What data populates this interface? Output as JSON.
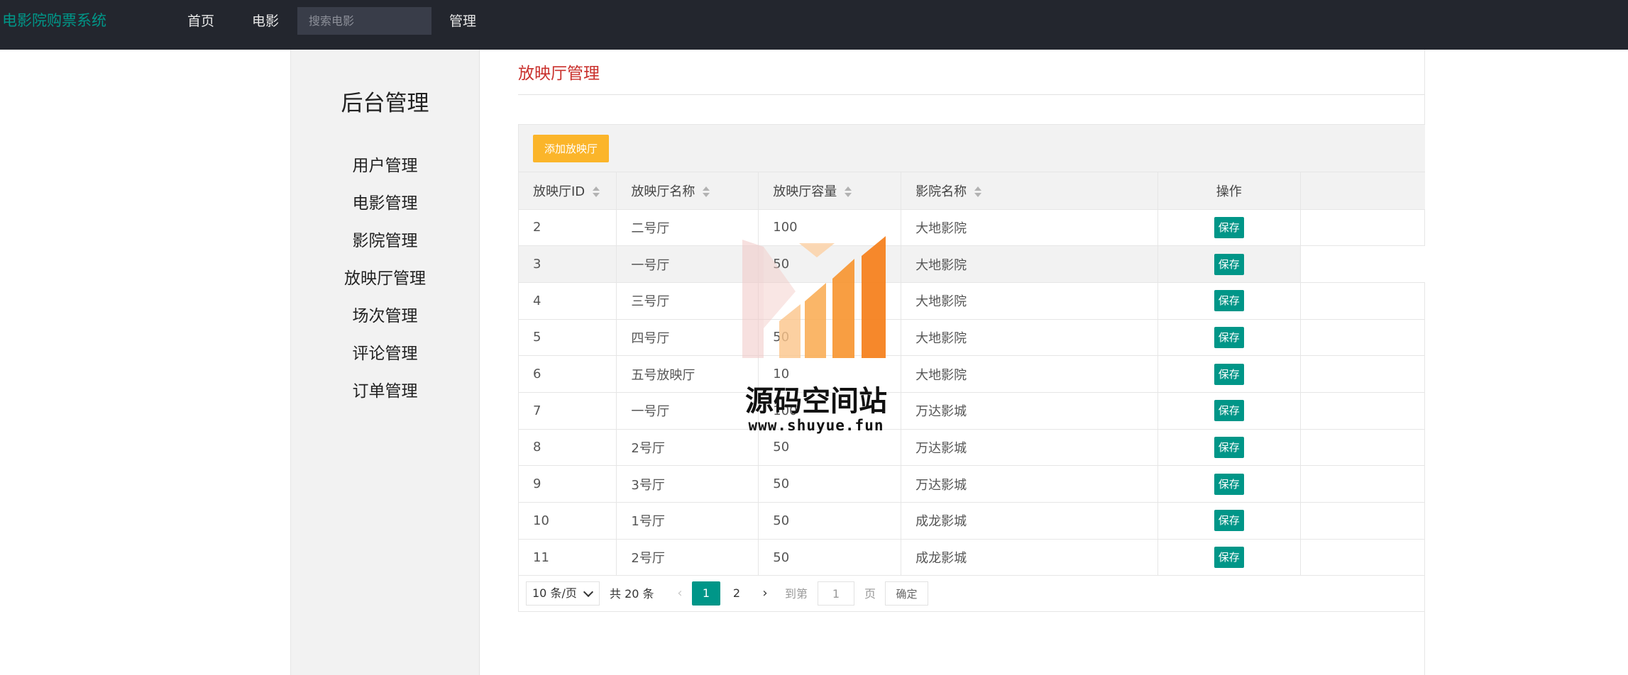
{
  "header": {
    "brand": "电影院购票系统",
    "nav": {
      "home": "首页",
      "movie": "电影",
      "admin": "管理"
    },
    "search_placeholder": "搜索电影"
  },
  "sidebar": {
    "title": "后台管理",
    "items": [
      "用户管理",
      "电影管理",
      "影院管理",
      "放映厅管理",
      "场次管理",
      "评论管理",
      "订单管理"
    ]
  },
  "main": {
    "title": "放映厅管理",
    "add_button": "添加放映厅",
    "columns": [
      "放映厅ID",
      "放映厅名称",
      "放映厅容量",
      "影院名称",
      "操作"
    ],
    "rows": [
      {
        "id": "2",
        "name": "二号厅",
        "capacity": "100",
        "cinema": "大地影院",
        "action": "保存"
      },
      {
        "id": "3",
        "name": "一号厅",
        "capacity": "50",
        "cinema": "大地影院",
        "action": "保存"
      },
      {
        "id": "4",
        "name": "三号厅",
        "capacity": "",
        "cinema": "大地影院",
        "action": "保存"
      },
      {
        "id": "5",
        "name": "四号厅",
        "capacity": "50",
        "cinema": "大地影院",
        "action": "保存"
      },
      {
        "id": "6",
        "name": "五号放映厅",
        "capacity": "10",
        "cinema": "大地影院",
        "action": "保存"
      },
      {
        "id": "7",
        "name": "一号厅",
        "capacity": "100",
        "cinema": "万达影城",
        "action": "保存"
      },
      {
        "id": "8",
        "name": "2号厅",
        "capacity": "50",
        "cinema": "万达影城",
        "action": "保存"
      },
      {
        "id": "9",
        "name": "3号厅",
        "capacity": "50",
        "cinema": "万达影城",
        "action": "保存"
      },
      {
        "id": "10",
        "name": "1号厅",
        "capacity": "50",
        "cinema": "成龙影城",
        "action": "保存"
      },
      {
        "id": "11",
        "name": "2号厅",
        "capacity": "50",
        "cinema": "成龙影城",
        "action": "保存"
      }
    ],
    "pagination": {
      "limit": "10 条/页",
      "total": "共 20 条",
      "current": "1",
      "next_page": "2",
      "goto_label": "到第",
      "goto_value": "1",
      "page_label": "页",
      "confirm": "确定"
    }
  },
  "watermark": {
    "name": "源码空间站",
    "url": "www.shuyue.fun"
  },
  "colors": {
    "header_bg": "#23262e",
    "brand": "#009688",
    "title": "#c9302c",
    "add_button": "#fbb52a",
    "save_button": "#009688"
  }
}
